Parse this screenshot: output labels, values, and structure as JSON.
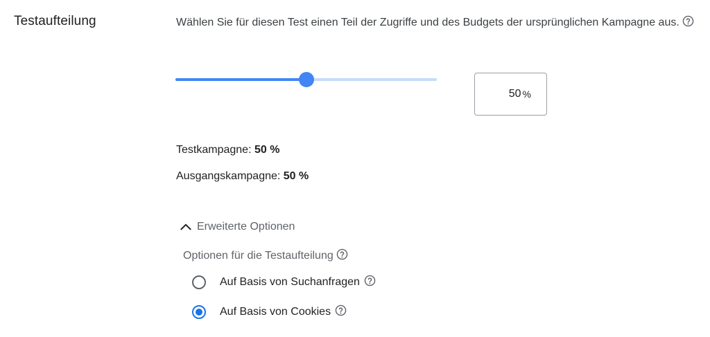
{
  "section": {
    "title": "Testaufteilung",
    "description": "Wählen Sie für diesen Test einen Teil der Zugriffe und des Budgets der ursprünglichen Kampagne aus."
  },
  "slider": {
    "value_percent": 50,
    "fill_color": "#4285f4",
    "track_color": "#c6dafc"
  },
  "percent_input": {
    "value": "50",
    "unit": "%"
  },
  "split": {
    "test_label": "Testkampagne:",
    "test_value": "50 %",
    "base_label": "Ausgangskampagne:",
    "base_value": "50 %"
  },
  "advanced": {
    "toggle_label": "Erweiterte Optionen",
    "expanded": true,
    "options_label": "Optionen für die Testaufteilung",
    "radios": [
      {
        "label": "Auf Basis von Suchanfragen",
        "checked": false
      },
      {
        "label": "Auf Basis von Cookies",
        "checked": true
      }
    ]
  },
  "colors": {
    "accent": "#1a73e8",
    "text_primary": "#202124",
    "text_secondary": "#5f6368"
  },
  "icons": {
    "help": "help-circle-outline-icon",
    "expand": "chevron-up-icon"
  }
}
